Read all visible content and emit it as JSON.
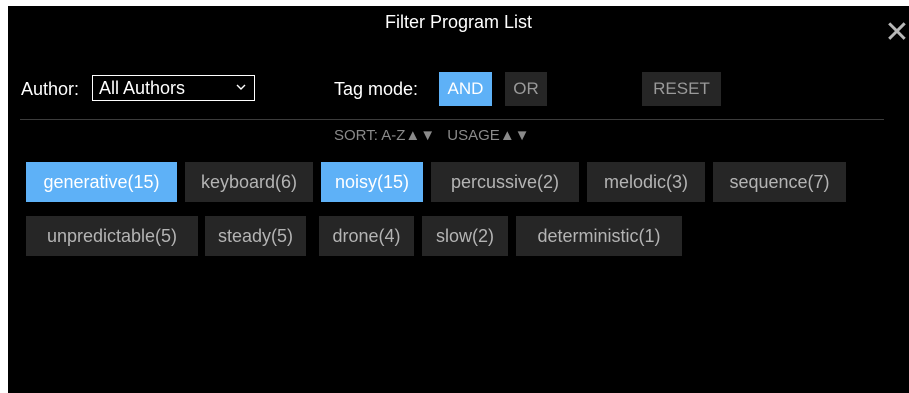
{
  "dialog": {
    "title": "Filter Program List",
    "close_icon": "close-icon"
  },
  "author": {
    "label": "Author:",
    "selected": "All Authors"
  },
  "tag_mode": {
    "label": "Tag mode:",
    "and_label": "AND",
    "or_label": "OR",
    "active": "AND",
    "reset_label": "RESET"
  },
  "sort": {
    "label_az": "SORT: A-Z",
    "label_usage": "USAGE",
    "up_arrow": "▲",
    "down_arrow": "▼"
  },
  "tags": [
    {
      "label": "generative(15)",
      "selected": true
    },
    {
      "label": "keyboard(6)",
      "selected": false
    },
    {
      "label": "noisy(15)",
      "selected": true
    },
    {
      "label": "percussive(2)",
      "selected": false
    },
    {
      "label": "melodic(3)",
      "selected": false
    },
    {
      "label": "sequence(7)",
      "selected": false
    },
    {
      "label": "unpredictable(5)",
      "selected": false
    },
    {
      "label": "steady(5)",
      "selected": false
    },
    {
      "label": "drone(4)",
      "selected": false
    },
    {
      "label": "slow(2)",
      "selected": false
    },
    {
      "label": "deterministic(1)",
      "selected": false
    }
  ],
  "colors": {
    "accent": "#5eb1f7",
    "background": "#000000",
    "chip": "#262626"
  }
}
